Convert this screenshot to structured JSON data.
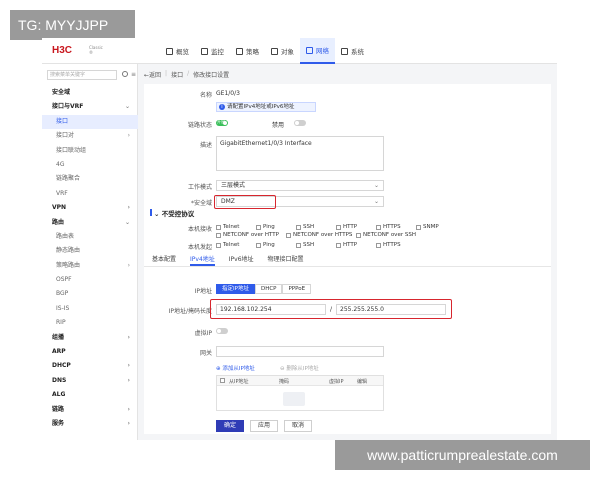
{
  "watermark_top": "TG: MYYJJPP",
  "watermark_bottom": "www.patticrumprealestate.com",
  "brand": {
    "logo": "H3C",
    "sub1": "Classic",
    "sub2": "®"
  },
  "nav": [
    {
      "label": "概览",
      "icon": "overview-icon"
    },
    {
      "label": "监控",
      "icon": "monitor-icon"
    },
    {
      "label": "策略",
      "icon": "policy-icon"
    },
    {
      "label": "对象",
      "icon": "object-icon"
    },
    {
      "label": "网络",
      "icon": "network-icon",
      "active": true
    },
    {
      "label": "系统",
      "icon": "system-icon"
    }
  ],
  "sidebar": {
    "search_placeholder": "搜索菜单关键字",
    "items": [
      {
        "label": "安全域",
        "type": "group"
      },
      {
        "label": "接口与VRF",
        "type": "group",
        "chev": "⌄"
      },
      {
        "label": "接口",
        "type": "sub",
        "active": true
      },
      {
        "label": "接口对",
        "type": "sub",
        "chev": "›"
      },
      {
        "label": "接口联动组",
        "type": "sub"
      },
      {
        "label": "4G",
        "type": "sub"
      },
      {
        "label": "链路聚合",
        "type": "sub"
      },
      {
        "label": "VRF",
        "type": "sub"
      },
      {
        "label": "VPN",
        "type": "group",
        "chev": "›"
      },
      {
        "label": "路由",
        "type": "group",
        "chev": "⌄"
      },
      {
        "label": "路由表",
        "type": "sub"
      },
      {
        "label": "静态路由",
        "type": "sub"
      },
      {
        "label": "策略路由",
        "type": "sub",
        "chev": "›"
      },
      {
        "label": "OSPF",
        "type": "sub"
      },
      {
        "label": "BGP",
        "type": "sub"
      },
      {
        "label": "IS-IS",
        "type": "sub"
      },
      {
        "label": "RIP",
        "type": "sub"
      },
      {
        "label": "组播",
        "type": "group",
        "chev": "›"
      },
      {
        "label": "ARP",
        "type": "group"
      },
      {
        "label": "DHCP",
        "type": "group",
        "chev": "›"
      },
      {
        "label": "DNS",
        "type": "group",
        "chev": "›"
      },
      {
        "label": "ALG",
        "type": "group"
      },
      {
        "label": "链路",
        "type": "group",
        "chev": "›"
      },
      {
        "label": "服务",
        "type": "group",
        "chev": "›"
      }
    ]
  },
  "breadcrumb": {
    "back": "←返回",
    "level1": "接口",
    "level2": "修改接口设置"
  },
  "form": {
    "name_label": "名称",
    "name_value": "GE1/0/3",
    "info_text": "请配置IPv4地址或IPv6地址",
    "status_label": "链路状态",
    "status_on": "开启",
    "status_off_label": "禁用",
    "desc_label": "描述",
    "desc_value": "GigabitEthernet1/0/3 Interface",
    "mode_label": "工作模式",
    "mode_value": "三层模式",
    "zone_label": "*安全域",
    "zone_value": "DMZ"
  },
  "protocols": {
    "title": "不受控协议",
    "local_label": "本机接收",
    "local_items": [
      "Telnet",
      "Ping",
      "SSH",
      "HTTP",
      "HTTPS",
      "SNMP",
      "NETCONF over HTTP",
      "NETCONF over HTTPS",
      "NETCONF over SSH"
    ],
    "out_label": "本机发起",
    "out_items": [
      "Telnet",
      "Ping",
      "SSH",
      "HTTP",
      "HTTPS"
    ]
  },
  "tabs": [
    "基本配置",
    "IPv4地址",
    "IPv6地址",
    "物理接口配置"
  ],
  "ipv4": {
    "ip_label": "IP地址",
    "modes": [
      "指定IP地址",
      "DHCP",
      "PPPoE"
    ],
    "addr_label": "IP地址/掩码长度",
    "ip_value": "192.168.102.254",
    "slash": "/",
    "mask_value": "255.255.255.0",
    "virtual_ip_label": "虚拟IP",
    "gateway_label": "网关",
    "add_sub_ip": "添加从IP地址",
    "del_sub_ip": "删除从IP地址",
    "columns": [
      "从IP地址",
      "掩码",
      "虚拟IP",
      "编辑"
    ]
  },
  "buttons": {
    "ok": "确定",
    "apply": "应用",
    "cancel": "取消"
  },
  "colors": {
    "accent": "#2f5bea",
    "highlight": "#d7262e",
    "toggle_on": "#3bbf5b",
    "brand": "#c8161d"
  }
}
